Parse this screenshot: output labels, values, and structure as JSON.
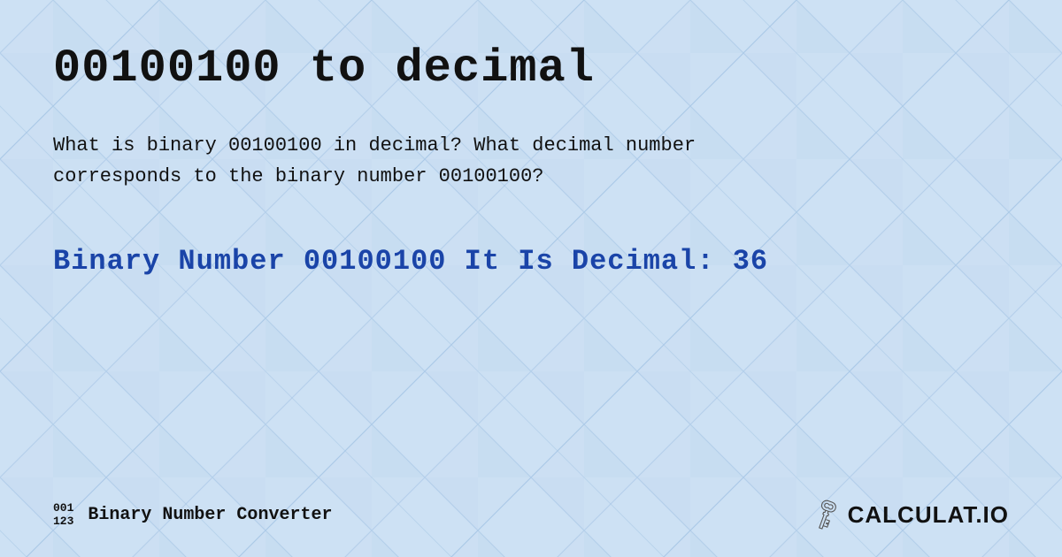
{
  "page": {
    "title": "00100100 to decimal",
    "description_line1": "What is binary 00100100 in decimal? What decimal number",
    "description_line2": "corresponds to the binary number 00100100?",
    "result": "Binary Number 00100100 It Is  Decimal: 36",
    "footer": {
      "logo_top": "001",
      "logo_bottom": "123",
      "converter_label": "Binary Number Converter",
      "brand_icon": "🔑",
      "brand_name": "CALCULAT.IO"
    }
  },
  "background": {
    "base_color": "#cce0f5",
    "pattern_color": "#b8d3ee"
  }
}
